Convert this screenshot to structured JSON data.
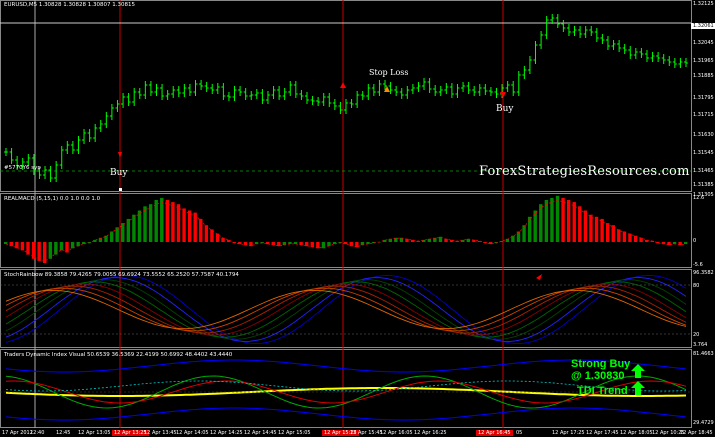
{
  "window": {
    "symbol_header": "EURUSD,M5  1.30828 1.30828 1.30807 1.30815",
    "watermark": "ForexStrategiesResources.com"
  },
  "price_axis": [
    "1.32125",
    "1.32061",
    "1.32045",
    "1.31965",
    "1.31885",
    "1.31795",
    "1.31715",
    "1.31630",
    "1.31545",
    "1.31465",
    "1.31385",
    "1.31305"
  ],
  "price_highlight": "1.32061",
  "price_level_label": "#5770Y6 syp",
  "signals": {
    "buy_1": "Buy",
    "buy_2": "Buy",
    "stop_loss": "Stop Loss"
  },
  "realmacd": {
    "title": "REALMACD (5,15,1) 0.0 1.0 0.0 1.0",
    "axis": [
      "12.6",
      "0",
      "-5.6"
    ]
  },
  "stochrainbow": {
    "title": "StochRainbow 89.3858 79.4265 79.0055 69.6924 73.5552 65.2520 57.7587 40.1794",
    "axis": [
      "96.3582",
      "80",
      "20",
      "3.764"
    ]
  },
  "tdi": {
    "title": "Traders Dynamic Index Visual 50.6539 36.5369 22.4199 50.6992 48.4402 43.4440",
    "axis": [
      "81.4663",
      "29.4729"
    ],
    "strong_buy": "Strong Buy",
    "strong_buy_price": "@ 1.30830",
    "trend_label": "TDI Trend"
  },
  "time_axis": [
    {
      "label": "17 Apr 2012",
      "red": false
    },
    {
      "label": "12:40",
      "red": false
    },
    {
      "label": "12:45",
      "red": false
    },
    {
      "label": "12 Apr 13:05",
      "red": false
    },
    {
      "label": "12 Apr 13:25",
      "red": true
    },
    {
      "label": "12 Apr 13:45",
      "red": false
    },
    {
      "label": "12 Apr 14:05",
      "red": false
    },
    {
      "label": "12 Apr 14:25",
      "red": false
    },
    {
      "label": "12 Apr 14:45",
      "red": false
    },
    {
      "label": "12 Apr 15:05",
      "red": false
    },
    {
      "label": "12 Apr 15:25",
      "red": true
    },
    {
      "label": "12 Apr 15:45",
      "red": false
    },
    {
      "label": "12 Apr 16:05",
      "red": false
    },
    {
      "label": "12 Apr 16:25",
      "red": false
    },
    {
      "label": "12 Apr 16:45",
      "red": true
    },
    {
      "label": "05",
      "red": false
    },
    {
      "label": "12 Apr 17:25",
      "red": false
    },
    {
      "label": "12 Apr 17:45",
      "red": false
    },
    {
      "label": "12 Apr 18:05",
      "red": false
    },
    {
      "label": "12 Apr 10:25",
      "red": false
    },
    {
      "label": "12 Apr 18:45",
      "red": false
    }
  ],
  "colors": {
    "candle": "#00ff00",
    "hist_up": "#008800",
    "hist_down": "#ff0000",
    "signal_line": "#ff0000",
    "tdi_yellow": "#ffff00",
    "tdi_blue": "#0000ff",
    "tdi_green": "#00aa00",
    "tdi_red": "#dd0000"
  }
}
